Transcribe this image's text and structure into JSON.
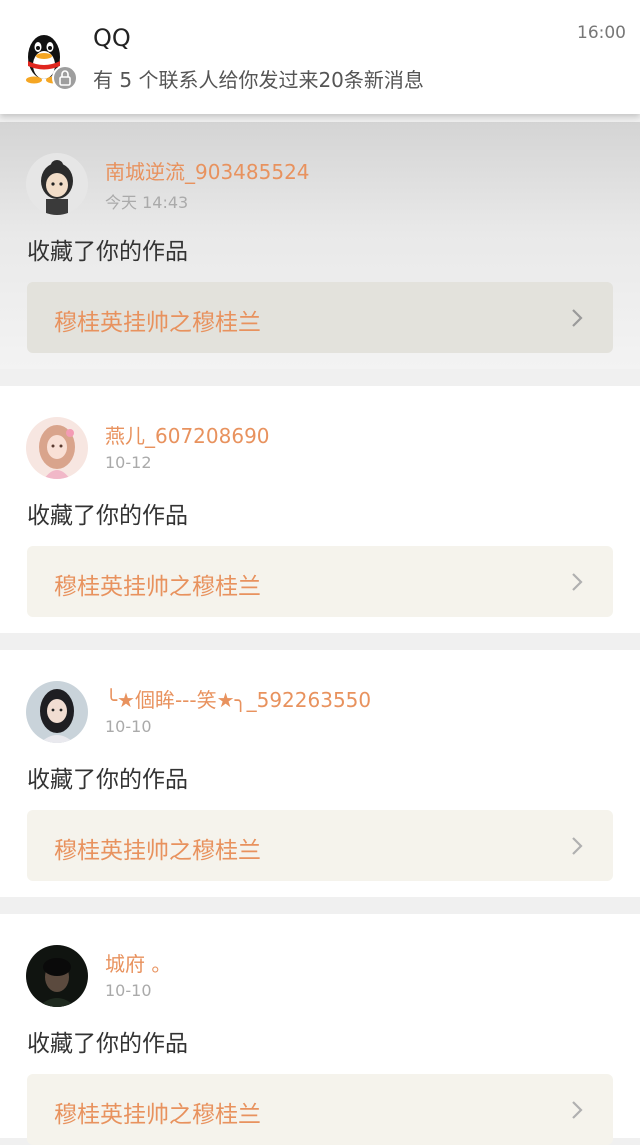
{
  "notification": {
    "app_name": "QQ",
    "message": "有 5 个联系人给你发过来20条新消息",
    "time": "16:00"
  },
  "feed": [
    {
      "username": "南城逆流_903485524",
      "time": "今天 14:43",
      "action": "收藏了你的作品",
      "work_title": "穆桂英挂帅之穆桂兰"
    },
    {
      "username": "燕儿_607208690",
      "time": "10-12",
      "action": "收藏了你的作品",
      "work_title": "穆桂英挂帅之穆桂兰"
    },
    {
      "username": "╰★個眸---笑★╮_592263550",
      "time": "10-10",
      "action": "收藏了你的作品",
      "work_title": "穆桂英挂帅之穆桂兰"
    },
    {
      "username": "城府 。",
      "time": "10-10",
      "action": "收藏了你的作品",
      "work_title": "穆桂英挂帅之穆桂兰"
    }
  ]
}
